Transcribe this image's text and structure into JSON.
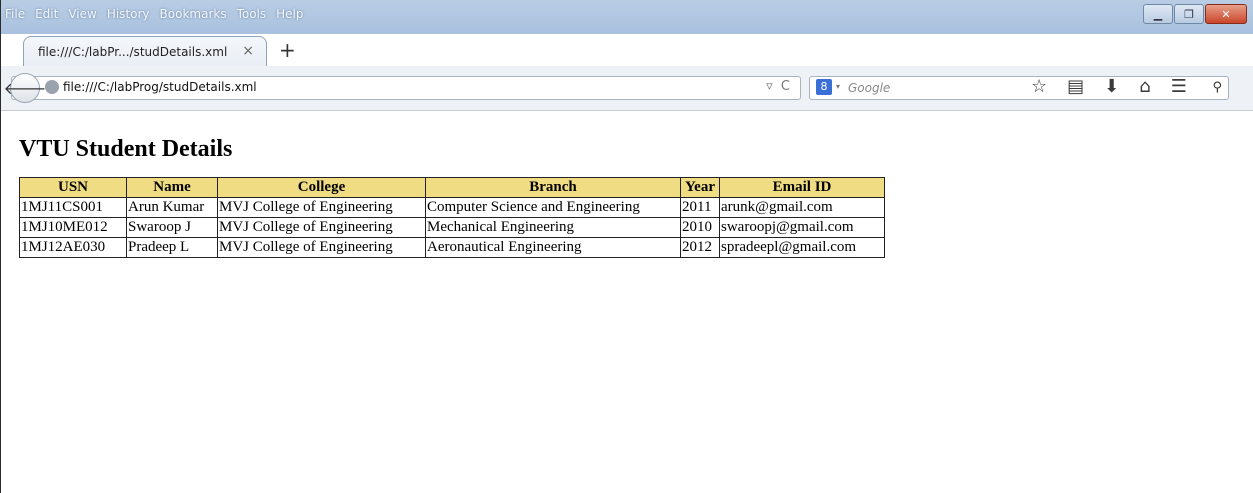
{
  "menu": [
    "File",
    "Edit",
    "View",
    "History",
    "Bookmarks",
    "Tools",
    "Help"
  ],
  "tab": {
    "label": "file:///C:/labPr.../studDetails.xml",
    "close": "×",
    "new": "+"
  },
  "address": {
    "url": "file:///C:/labProg/studDetails.xml"
  },
  "search": {
    "placeholder": "Google",
    "engine_letter": "8"
  },
  "page": {
    "title": "VTU Student Details",
    "columns": [
      "USN",
      "Name",
      "College",
      "Branch",
      "Year",
      "Email ID"
    ],
    "rows": [
      [
        "1MJ11CS001",
        "Arun Kumar",
        "MVJ College of Engineering",
        "Computer Science and Engineering",
        "2011",
        "arunk@gmail.com"
      ],
      [
        "1MJ10ME012",
        "Swaroop J",
        "MVJ College of Engineering",
        "Mechanical Engineering",
        "2010",
        "swaroopj@gmail.com"
      ],
      [
        "1MJ12AE030",
        "Pradeep L",
        "MVJ College of Engineering",
        "Aeronautical Engineering",
        "2012",
        "spradeepl@gmail.com"
      ]
    ]
  },
  "colors": {
    "header_bg": "#f0dc82"
  }
}
